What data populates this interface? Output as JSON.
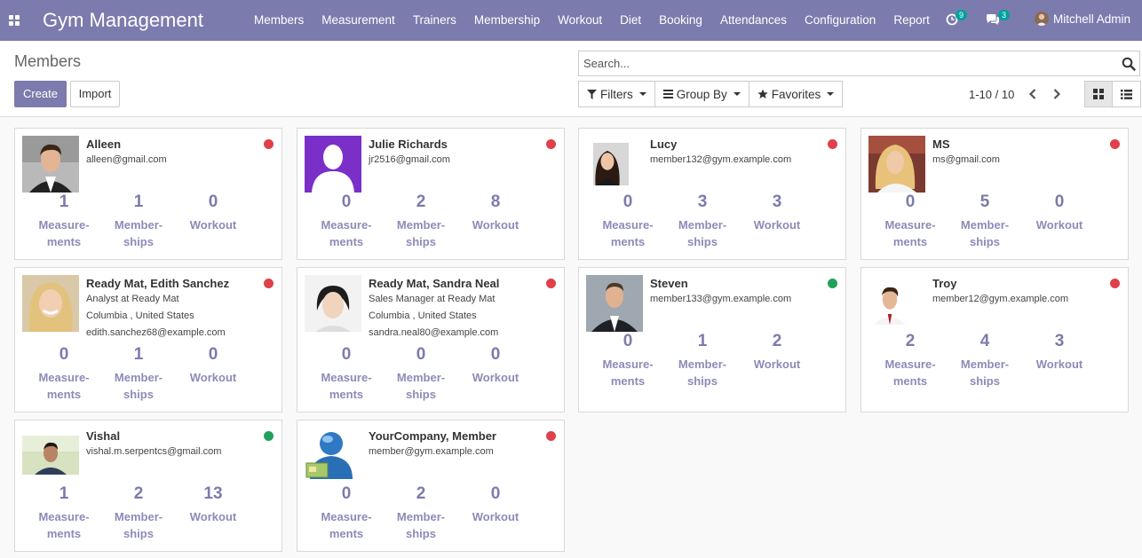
{
  "app": {
    "brand": "Gym Management",
    "menu": [
      "Members",
      "Measurement",
      "Trainers",
      "Membership",
      "Workout",
      "Diet",
      "Booking",
      "Attendances",
      "Configuration",
      "Report"
    ],
    "activity_count": "9",
    "messages_count": "3",
    "user_name": "Mitchell Admin",
    "accent_color": "#7c7bad"
  },
  "control_panel": {
    "title": "Members",
    "create_label": "Create",
    "import_label": "Import",
    "search_placeholder": "Search...",
    "filters_label": "Filters",
    "groupby_label": "Group By",
    "favorites_label": "Favorites",
    "pager": "1-10 / 10",
    "active_view": "kanban"
  },
  "stat_labels": {
    "measurements_1": "Measure-",
    "measurements_2": "ments",
    "memberships_1": "Member-",
    "memberships_2": "ships",
    "workout": "Workout"
  },
  "members": [
    {
      "name": "Alleen",
      "lines": [
        "alleen@gmail.com"
      ],
      "measurements": "1",
      "memberships": "1",
      "workout": "0",
      "status": "red",
      "photo": "young-man-dark-hair-suit"
    },
    {
      "name": "Julie Richards",
      "lines": [
        "jr2516@gmail.com"
      ],
      "measurements": "0",
      "memberships": "2",
      "workout": "8",
      "status": "red",
      "photo": "placeholder-silhouette-purple"
    },
    {
      "name": "Lucy",
      "lines": [
        "member132@gym.example.com"
      ],
      "measurements": "0",
      "memberships": "3",
      "workout": "3",
      "status": "red",
      "photo": "woman-dark-hair"
    },
    {
      "name": "MS",
      "lines": [
        "ms@gmail.com"
      ],
      "measurements": "0",
      "memberships": "5",
      "workout": "0",
      "status": "red",
      "photo": "woman-blonde-curly"
    },
    {
      "name": "Ready Mat, Edith Sanchez",
      "lines": [
        "Analyst at Ready Mat",
        "Columbia , United States",
        "edith.sanchez68@example.com"
      ],
      "measurements": "0",
      "memberships": "1",
      "workout": "0",
      "status": "red",
      "photo": "woman-blonde-smiling"
    },
    {
      "name": "Ready Mat, Sandra Neal",
      "lines": [
        "Sales Manager at Ready Mat",
        "Columbia , United States",
        "sandra.neal80@example.com"
      ],
      "measurements": "0",
      "memberships": "0",
      "workout": "0",
      "status": "red",
      "photo": "woman-short-dark-hair"
    },
    {
      "name": "Steven",
      "lines": [
        "member133@gym.example.com"
      ],
      "measurements": "0",
      "memberships": "1",
      "workout": "2",
      "status": "green",
      "photo": "man-suit-office"
    },
    {
      "name": "Troy",
      "lines": [
        "member12@gym.example.com"
      ],
      "measurements": "2",
      "memberships": "4",
      "workout": "3",
      "status": "red",
      "photo": "young-man-red-tie"
    },
    {
      "name": "Vishal",
      "lines": [
        "vishal.m.serpentcs@gmail.com"
      ],
      "measurements": "1",
      "memberships": "2",
      "workout": "13",
      "status": "green",
      "photo": "man-outdoors"
    },
    {
      "name": "YourCompany, Member",
      "lines": [
        "member@gym.example.com"
      ],
      "measurements": "0",
      "memberships": "2",
      "workout": "0",
      "status": "red",
      "photo": "blue-user-icon-with-card"
    }
  ],
  "status_colors": {
    "red": "#e0404a",
    "green": "#21a05a"
  }
}
